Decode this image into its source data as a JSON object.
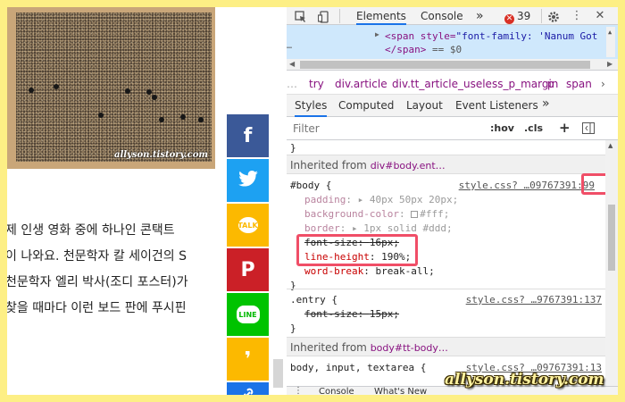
{
  "colors": {
    "frame": "#fdef85",
    "facebook": "#3b5998",
    "twitter": "#1da1f2",
    "kakaotalk": "#fcb900",
    "pinterest": "#cb2027",
    "line": "#00c300",
    "brunch": "#fcb900",
    "link": "#1a73e8",
    "highlight": "#f04e67"
  },
  "article": {
    "image_watermark": "allyson.tistory.com",
    "lines": [
      "제 인생 영화 중에 하나인 콘택트",
      "이 나와요. 천문학자 칼 세이건의 S",
      "천문학자 엘리 박사(조디 포스터)가",
      "찾을 때마다 이런 보드 판에 푸시핀"
    ]
  },
  "share": [
    {
      "name": "facebook",
      "glyph": "f",
      "icon": "facebook-icon"
    },
    {
      "name": "twitter",
      "glyph": "🐦",
      "icon": "twitter-icon"
    },
    {
      "name": "kakaotalk",
      "glyph": "TALK",
      "icon": "kakaotalk-icon"
    },
    {
      "name": "pinterest",
      "glyph": "P",
      "icon": "pinterest-icon"
    },
    {
      "name": "line",
      "glyph": "LINE",
      "icon": "line-icon"
    },
    {
      "name": "brunch",
      "glyph": "❜",
      "icon": "brunch-icon"
    },
    {
      "name": "link",
      "glyph": "🔗",
      "icon": "link-icon"
    }
  ],
  "devtools": {
    "tabs": {
      "elements": "Elements",
      "console": "Console",
      "more": "»"
    },
    "error_count": "39",
    "dom": {
      "line1_tag": "<span style=",
      "line1_val": "\"font-family: 'Nanum Got",
      "line2": "</span>",
      "line2_eq": " == $0"
    },
    "breadcrumbs": [
      "try",
      "div.article",
      "div.tt_article_useless_p_margin",
      "p",
      "span"
    ],
    "subtabs": {
      "styles": "Styles",
      "computed": "Computed",
      "layout": "Layout",
      "listeners": "Event Listeners",
      "more": "»"
    },
    "filter": {
      "placeholder": "Filter",
      "hov": ":hov",
      "cls": ".cls",
      "plus": "+"
    },
    "styles": {
      "top_brace": "}",
      "inherited1_label": "Inherited from",
      "inherited1_tag": "div#body.ent…",
      "rule1": {
        "selector": "#body {",
        "source_prefix": "style.css? …09767391:",
        "source_line": "99",
        "props": [
          {
            "name": "padding",
            "value": "▸ 40px 50px 20px;"
          },
          {
            "name": "background-color",
            "value": "#fff;"
          },
          {
            "name": "border",
            "value": "▸ 1px solid  #ddd;"
          },
          {
            "name": "font-size",
            "value": "16px;"
          },
          {
            "name": "line-height",
            "value": "190%;"
          },
          {
            "name": "word-break",
            "value": "break-all;"
          }
        ],
        "close": "}"
      },
      "rule2": {
        "selector": ".entry {",
        "source": "style.css? …9767391:137",
        "prop_name": "font-size",
        "prop_value": "15px;",
        "close": "}"
      },
      "inherited2_label": "Inherited from",
      "inherited2_tag": "body#tt-body…",
      "rule3": {
        "selector": "body, input, textarea {",
        "source": "style.css? …09767391:13"
      }
    },
    "drawer": {
      "console": "Console",
      "whatsnew": "What's New"
    }
  },
  "watermark": "allyson.tistory.com"
}
